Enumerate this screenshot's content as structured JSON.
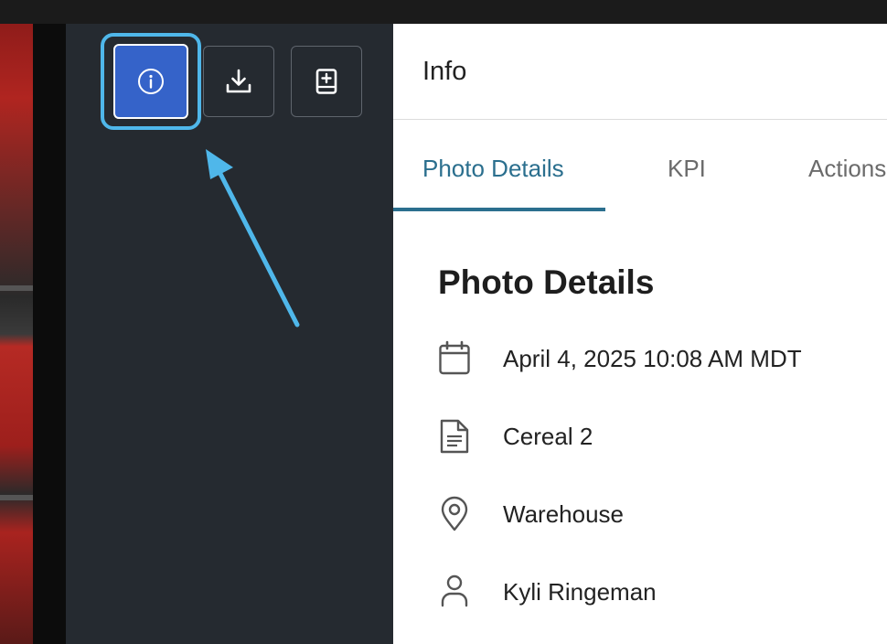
{
  "toolbar": {
    "buttons": [
      {
        "icon": "info-icon",
        "active": true
      },
      {
        "icon": "download-icon",
        "active": false
      },
      {
        "icon": "add-to-book-icon",
        "active": false
      }
    ]
  },
  "panel": {
    "title": "Info",
    "tabs": [
      {
        "label": "Photo Details",
        "active": true
      },
      {
        "label": "KPI",
        "active": false
      },
      {
        "label": "Actions",
        "active": false
      }
    ],
    "section_title": "Photo Details",
    "details": [
      {
        "icon": "calendar-icon",
        "text": "April 4, 2025 10:08 AM MDT"
      },
      {
        "icon": "document-icon",
        "text": "Cereal 2"
      },
      {
        "icon": "location-pin-icon",
        "text": "Warehouse"
      },
      {
        "icon": "person-icon",
        "text": "Kyli Ringeman"
      }
    ]
  },
  "colors": {
    "accent": "#3563c9",
    "focus_ring": "#4fb7ea",
    "tab_active": "#2b6f8e",
    "dark_bg": "#252a30"
  }
}
